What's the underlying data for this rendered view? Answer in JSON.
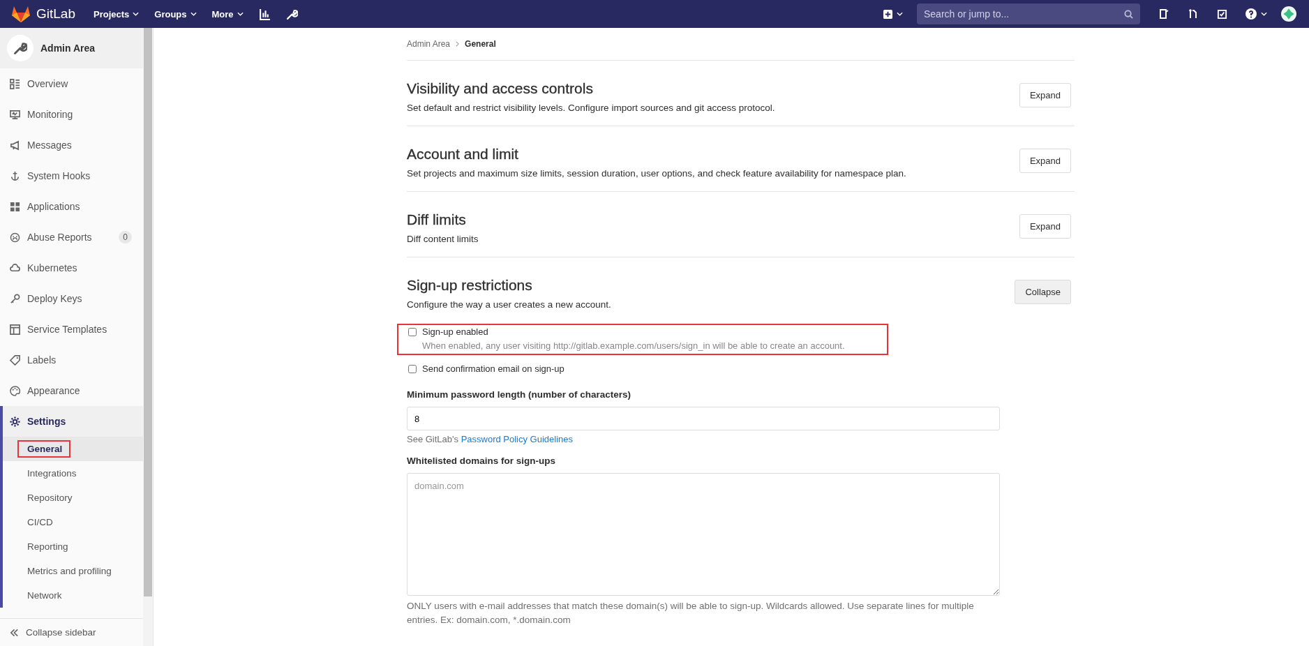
{
  "topbar": {
    "brand": "GitLab",
    "menus": [
      {
        "label": "Projects"
      },
      {
        "label": "Groups"
      },
      {
        "label": "More"
      }
    ],
    "search": {
      "placeholder": "Search or jump to..."
    }
  },
  "sidebar": {
    "title": "Admin Area",
    "items": [
      {
        "label": "Overview",
        "selected": false
      },
      {
        "label": "Monitoring",
        "selected": false
      },
      {
        "label": "Messages",
        "selected": false
      },
      {
        "label": "System Hooks",
        "selected": false
      },
      {
        "label": "Applications",
        "selected": false
      },
      {
        "label": "Abuse Reports",
        "selected": false,
        "badge": "0"
      },
      {
        "label": "Kubernetes",
        "selected": false
      },
      {
        "label": "Deploy Keys",
        "selected": false
      },
      {
        "label": "Service Templates",
        "selected": false
      },
      {
        "label": "Labels",
        "selected": false
      },
      {
        "label": "Appearance",
        "selected": false
      },
      {
        "label": "Settings",
        "selected": true,
        "expanded": true,
        "children": [
          {
            "label": "General",
            "selected": true,
            "highlighted": true
          },
          {
            "label": "Integrations",
            "selected": false,
            "highlighted": false
          },
          {
            "label": "Repository",
            "selected": false,
            "highlighted": false
          },
          {
            "label": "CI/CD",
            "selected": false,
            "highlighted": false
          },
          {
            "label": "Reporting",
            "selected": false,
            "highlighted": false
          },
          {
            "label": "Metrics and profiling",
            "selected": false,
            "highlighted": false
          },
          {
            "label": "Network",
            "selected": false,
            "highlighted": false
          }
        ]
      }
    ],
    "collapse": "Collapse sidebar"
  },
  "breadcrumb": [
    "Admin Area",
    "General"
  ],
  "sections": [
    {
      "title": "Visibility and access controls",
      "description": "Set default and restrict visibility levels. Configure import sources and git access protocol.",
      "button": "Expand",
      "expanded": false
    },
    {
      "title": "Account and limit",
      "description": "Set projects and maximum size limits, session duration, user options, and check feature availability for namespace plan.",
      "button": "Expand",
      "expanded": false
    },
    {
      "title": "Diff limits",
      "description": "Diff content limits",
      "button": "Expand",
      "expanded": false
    },
    {
      "title": "Sign-up restrictions",
      "description": "Configure the way a user creates a new account.",
      "button": "Collapse",
      "expanded": true
    }
  ],
  "signup": {
    "checkboxes": [
      {
        "label": "Sign-up enabled",
        "checked": false,
        "highlighted": true,
        "help": "When enabled, any user visiting http://gitlab.example.com/users/sign_in will be able to create an account."
      },
      {
        "label": "Send confirmation email on sign-up",
        "checked": false,
        "highlighted": false
      }
    ],
    "min_password": {
      "label": "Minimum password length (number of characters)",
      "value": "8",
      "help": "See GitLab's",
      "link": "Password Policy Guidelines"
    },
    "whitelist": {
      "label": "Whitelisted domains for sign-ups",
      "placeholder": "domain.com",
      "help": "ONLY users with e-mail addresses that match these domain(s) will be able to sign-up. Wildcards allowed. Use separate lines for multiple entries. Ex: domain.com, *.domain.com"
    }
  }
}
